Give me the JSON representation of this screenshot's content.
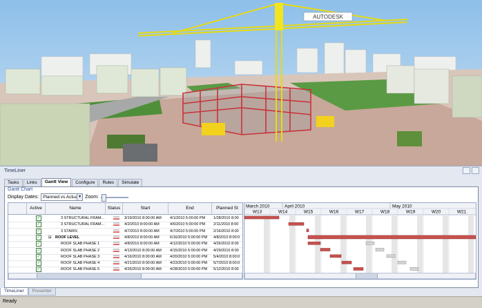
{
  "viewport": {
    "crane_sign": "AUTODESK",
    "colors": {
      "sky": "#9fc7ec",
      "ground": "#c8a89a",
      "crane": "#f2e520",
      "steel": "#c8323a",
      "grass": "#4f8f3a"
    }
  },
  "timeliner": {
    "title": "TimeLiner",
    "tabs": [
      "Tasks",
      "Links",
      "Gantt View",
      "Configure",
      "Rules",
      "Simulate"
    ],
    "active_tab": "Gantt View",
    "gantt_label": "Gantt Chart",
    "display_dates_label": "Display Dates:",
    "display_dates_value": "Planned vs Actual",
    "zoom_label": "Zoom:",
    "columns": {
      "active": "Active",
      "name": "Name",
      "status": "Status",
      "start": "Start",
      "end": "End",
      "planned": "Planned St"
    },
    "rows": [
      {
        "name": "3 STRUCTURAL FRAM...",
        "start": "3/19/2010 8:00:00 AM",
        "end": "4/1/2010 5:00:00 PM",
        "planned": "1/28/2010 8:00"
      },
      {
        "name": "3 STRUCTURAL FRAM...",
        "start": "4/2/2010 8:00:00 AM",
        "end": "4/6/2010 5:00:00 PM",
        "planned": "2/11/2010 8:00"
      },
      {
        "name": "3 STAIRS",
        "start": "4/7/2010 8:00:00 AM",
        "end": "4/7/2010 5:00:00 PM",
        "planned": "2/16/2010 8:00"
      },
      {
        "name": "ROOF LEVEL",
        "start": "4/8/2010 8:00:00 AM",
        "end": "6/16/2010 5:00:00 PM",
        "planned": "4/8/2010 8:00:0"
      },
      {
        "name": "ROOF SLAB PHASE 1",
        "start": "4/8/2010 8:00:00 AM",
        "end": "4/12/2010 5:00:00 PM",
        "planned": "4/26/2010 8:00"
      },
      {
        "name": "ROOF SLAB PHASE 2",
        "start": "4/13/2010 8:00:00 AM",
        "end": "4/15/2010 5:00:00 PM",
        "planned": "4/29/2010 8:00"
      },
      {
        "name": "ROOF SLAB PHASE 3",
        "start": "4/16/2010 8:00:00 AM",
        "end": "4/20/2010 5:00:00 PM",
        "planned": "5/4/2010 8:00:0"
      },
      {
        "name": "ROOF SLAB PHASE 4",
        "start": "4/21/2010 8:00:00 AM",
        "end": "4/23/2010 5:00:00 PM",
        "planned": "5/7/2010 8:00:0"
      },
      {
        "name": "ROOF SLAB PHASE 5",
        "start": "4/26/2010 8:00:00 AM",
        "end": "4/28/2010 5:00:00 PM",
        "planned": "5/12/2010 8:00"
      }
    ],
    "months": [
      "March 2010",
      "April 2010",
      "May 2010"
    ],
    "weeks": [
      "W13",
      "W14",
      "W15",
      "W16",
      "W17",
      "W18",
      "W19",
      "W20",
      "W21"
    ],
    "colors": {
      "actual_bar": "#c8524f",
      "planned_bar": "#d6d6d6",
      "bar_outline": "#8b2f2d"
    }
  },
  "bottom_tabs": [
    "TimeLiner",
    "Presenter"
  ],
  "statusbar": {
    "text": "Ready"
  }
}
